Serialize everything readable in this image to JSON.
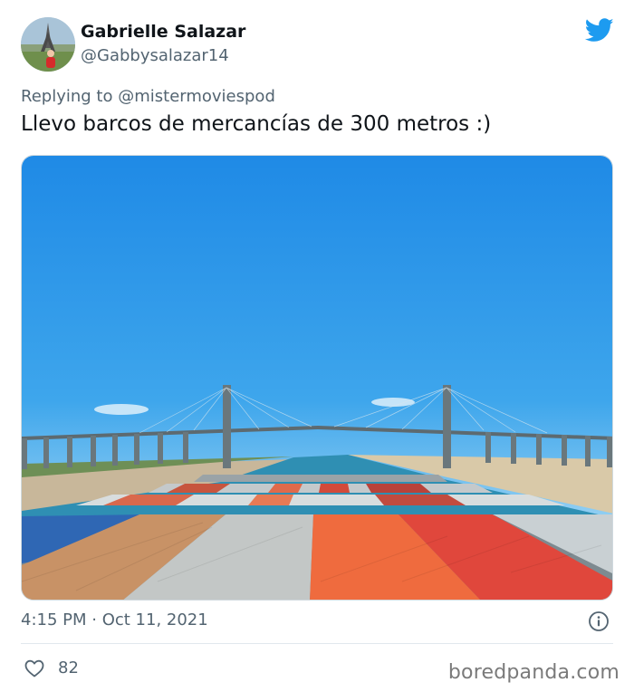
{
  "author": {
    "display_name": "Gabrielle Salazar",
    "handle": "@Gabbysalazar14"
  },
  "reply": {
    "prefix": "Replying to",
    "mention": "@mistermoviespod"
  },
  "tweet": {
    "text": "Llevo barcos de mercancías de 300 metros :)",
    "timestamp": "4:15 PM · Oct 11, 2021",
    "likes": "82"
  },
  "watermark": "boredpanda.com",
  "colors": {
    "twitter_blue": "#1d9bf0",
    "secondary_text": "#536471",
    "primary_text": "#0f1419"
  },
  "icons": {
    "brand": "twitter-bird-icon",
    "info": "info-icon",
    "like": "heart-icon"
  }
}
